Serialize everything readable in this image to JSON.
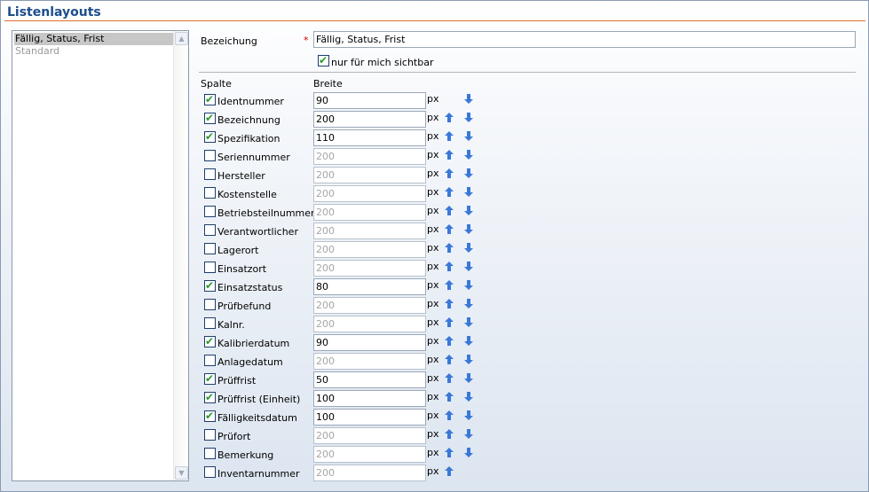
{
  "page": {
    "title": "Listenlayouts"
  },
  "layouts": [
    {
      "label": "Fällig, Status, Frist",
      "selected": true
    },
    {
      "label": "Standard",
      "selected": false
    }
  ],
  "form": {
    "name_label": "Bezeichung",
    "required_marker": "*",
    "name_value": "Fällig, Status, Frist",
    "private_label": "nur für mich sichtbar",
    "private_checked": true,
    "col_header_column": "Spalte",
    "col_header_width": "Breite",
    "unit": "px"
  },
  "columns": [
    {
      "name": "Identnummer",
      "checked": true,
      "width": "90"
    },
    {
      "name": "Bezeichnung",
      "checked": true,
      "width": "200"
    },
    {
      "name": "Spezifikation",
      "checked": true,
      "width": "110"
    },
    {
      "name": "Seriennummer",
      "checked": false,
      "width": "200"
    },
    {
      "name": "Hersteller",
      "checked": false,
      "width": "200"
    },
    {
      "name": "Kostenstelle",
      "checked": false,
      "width": "200"
    },
    {
      "name": "Betriebsteilnummer",
      "checked": false,
      "width": "200"
    },
    {
      "name": "Verantwortlicher",
      "checked": false,
      "width": "200"
    },
    {
      "name": "Lagerort",
      "checked": false,
      "width": "200"
    },
    {
      "name": "Einsatzort",
      "checked": false,
      "width": "200"
    },
    {
      "name": "Einsatzstatus",
      "checked": true,
      "width": "80"
    },
    {
      "name": "Prüfbefund",
      "checked": false,
      "width": "200"
    },
    {
      "name": "Kalnr.",
      "checked": false,
      "width": "200"
    },
    {
      "name": "Kalibrierdatum",
      "checked": true,
      "width": "90"
    },
    {
      "name": "Anlagedatum",
      "checked": false,
      "width": "200"
    },
    {
      "name": "Prüffrist",
      "checked": true,
      "width": "50"
    },
    {
      "name": "Prüffrist (Einheit)",
      "checked": true,
      "width": "100"
    },
    {
      "name": "Fälligkeitsdatum",
      "checked": true,
      "width": "100"
    },
    {
      "name": "Prüfort",
      "checked": false,
      "width": "200"
    },
    {
      "name": "Bemerkung",
      "checked": false,
      "width": "200"
    },
    {
      "name": "Inventarnummer",
      "checked": false,
      "width": "200"
    }
  ],
  "colors": {
    "title": "#1b4e8c",
    "title_rule": "#e07030",
    "arrow": "#3a78d8",
    "check": "#2a9a2a"
  }
}
